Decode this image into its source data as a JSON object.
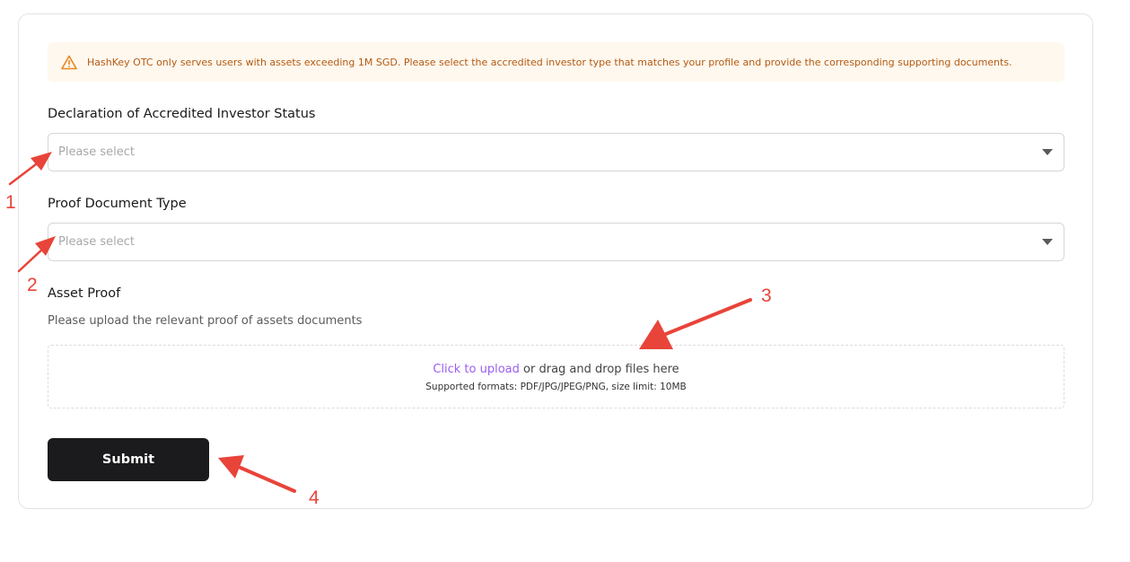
{
  "notice": {
    "icon": "warning-icon",
    "accent_color": "#e8871e",
    "text": "HashKey OTC only serves users with assets exceeding 1M SGD. Please select the accredited investor type that matches your profile and provide the corresponding supporting documents."
  },
  "declaration": {
    "label": "Declaration of Accredited Investor Status",
    "placeholder": "Please select"
  },
  "proof_type": {
    "label": "Proof Document Type",
    "placeholder": "Please select"
  },
  "asset_proof": {
    "label": "Asset Proof",
    "hint": "Please upload the relevant proof of assets documents",
    "upload_link": "Click to upload",
    "upload_text": " or drag and drop files here",
    "upload_formats": "Supported formats: PDF/JPG/JPEG/PNG, size limit: 10MB"
  },
  "submit": {
    "label": "Submit"
  },
  "annotations": {
    "color": "#e8443a",
    "numbers": [
      "1",
      "2",
      "3",
      "4"
    ]
  }
}
